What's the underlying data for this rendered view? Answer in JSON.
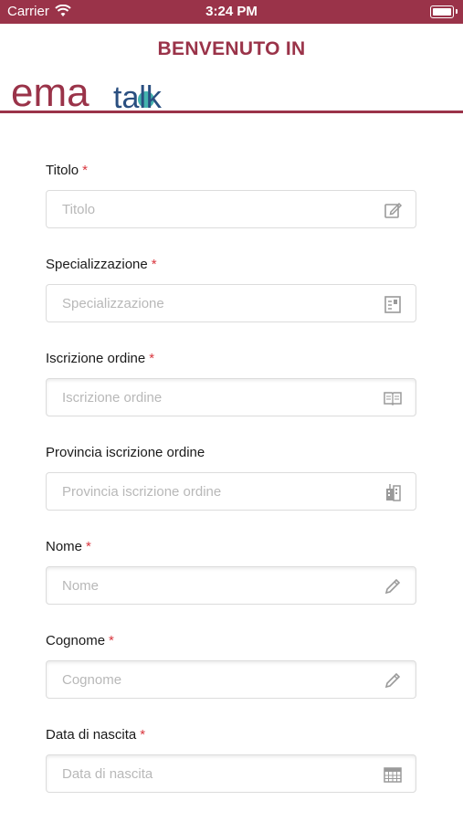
{
  "status": {
    "carrier": "Carrier",
    "time": "3:24 PM"
  },
  "header": {
    "welcome": "BENVENUTO IN",
    "logo_text_a": "ema",
    "logo_text_b": "talk",
    "brand_color": "#9a3349"
  },
  "fields": [
    {
      "label": "Titolo",
      "required": "*",
      "placeholder": "Titolo",
      "icon": "edit-icon"
    },
    {
      "label": "Specializzazione",
      "required": "*",
      "placeholder": "Specializzazione",
      "icon": "document-icon"
    },
    {
      "label": "Iscrizione ordine",
      "required": "*",
      "placeholder": "Iscrizione ordine",
      "icon": "book-icon"
    },
    {
      "label": "Provincia iscrizione ordine",
      "required": "",
      "placeholder": "Provincia iscrizione ordine",
      "icon": "building-icon"
    },
    {
      "label": "Nome",
      "required": "*",
      "placeholder": "Nome",
      "icon": "pencil-icon"
    },
    {
      "label": "Cognome",
      "required": "*",
      "placeholder": "Cognome",
      "icon": "pencil-icon"
    },
    {
      "label": "Data di nascita",
      "required": "*",
      "placeholder": "Data di nascita",
      "icon": "calendar-icon"
    }
  ]
}
